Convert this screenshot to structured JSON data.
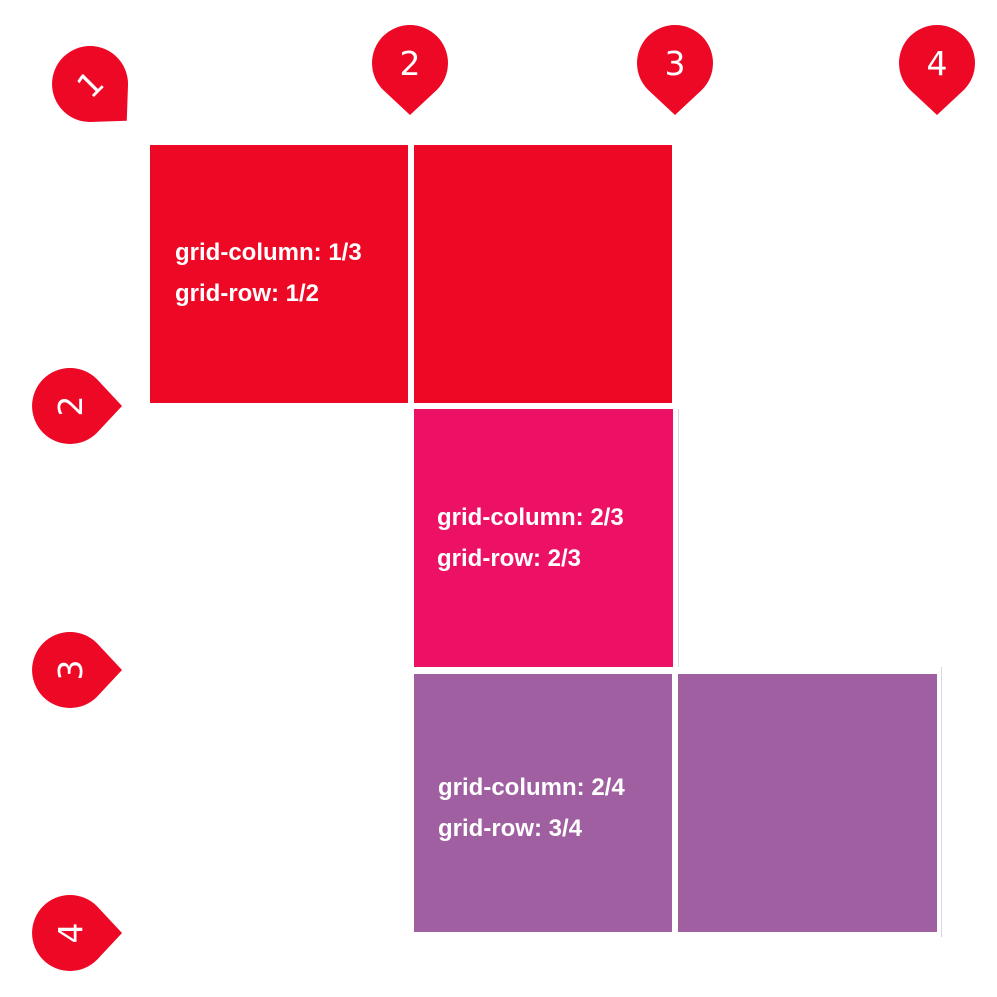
{
  "colors": {
    "red": "#ed0925",
    "pink": "#ed1165",
    "purple": "#9f5fa1",
    "marker": "#ed0925",
    "text": "#ffffff",
    "guide": "#d8d4ee"
  },
  "column_markers": [
    "1",
    "2",
    "3",
    "4"
  ],
  "row_markers": [
    "1",
    "2",
    "3",
    "4"
  ],
  "items": [
    {
      "id": "item-a",
      "color": "red",
      "line1": "grid-column: 1/3",
      "line2": "grid-row: 1/2"
    },
    {
      "id": "item-b",
      "color": "pink",
      "line1": "grid-column: 2/3",
      "line2": "grid-row: 2/3"
    },
    {
      "id": "item-c",
      "color": "purple",
      "line1": "grid-column: 2/4",
      "line2": "grid-row: 3/4"
    }
  ]
}
